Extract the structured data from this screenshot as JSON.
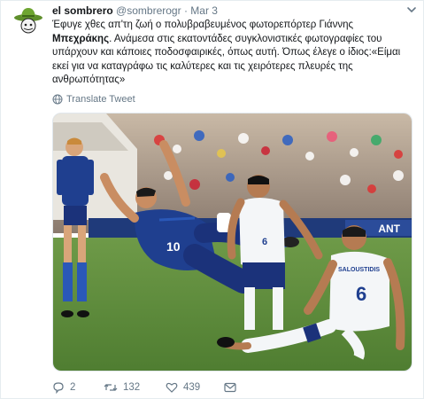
{
  "tweet": {
    "author_name": "el sombrero",
    "handle": "@sombrerogr",
    "separator": "·",
    "date": "Mar 3",
    "text_part1": "Έφυγε χθες απ'τη ζωή ο πολυβραβευμένος φωτορεπόρτερ Γιάννης ",
    "text_bold": "Μπεχράκης",
    "text_part2": ". Ανάμεσα στις εκατοντάδες συγκλονιστικές φωτογραφίες του υπάρχουν και κάποιες ποδοσφαιρικές, όπως αυτή. Όπως έλεγε ο ίδιος:«Είμαι εκεί για να καταγράφω τις καλύτερες και τις χειρότερες πλευρές της ανθρωπότητας»",
    "translate_label": "Translate Tweet",
    "photo": {
      "jersey_left": "10",
      "jersey_right_number": "6",
      "jersey_right_name": "SALOUSTIDIS",
      "jersey_mid": "6",
      "board_text": "ANT"
    }
  },
  "actions": {
    "reply_count": "2",
    "retweet_count": "132",
    "like_count": "439"
  },
  "colors": {
    "text": "#14171a",
    "secondary": "#657786",
    "border": "#e6ecf0",
    "pitch": "#5d8a3c",
    "blue_kit": "#1f3f8f",
    "white_kit": "#f4f6f8"
  },
  "icons": [
    "sombrero-avatar-icon",
    "chevron-down-icon",
    "globe-icon",
    "reply-icon",
    "retweet-icon",
    "like-icon",
    "message-icon"
  ]
}
